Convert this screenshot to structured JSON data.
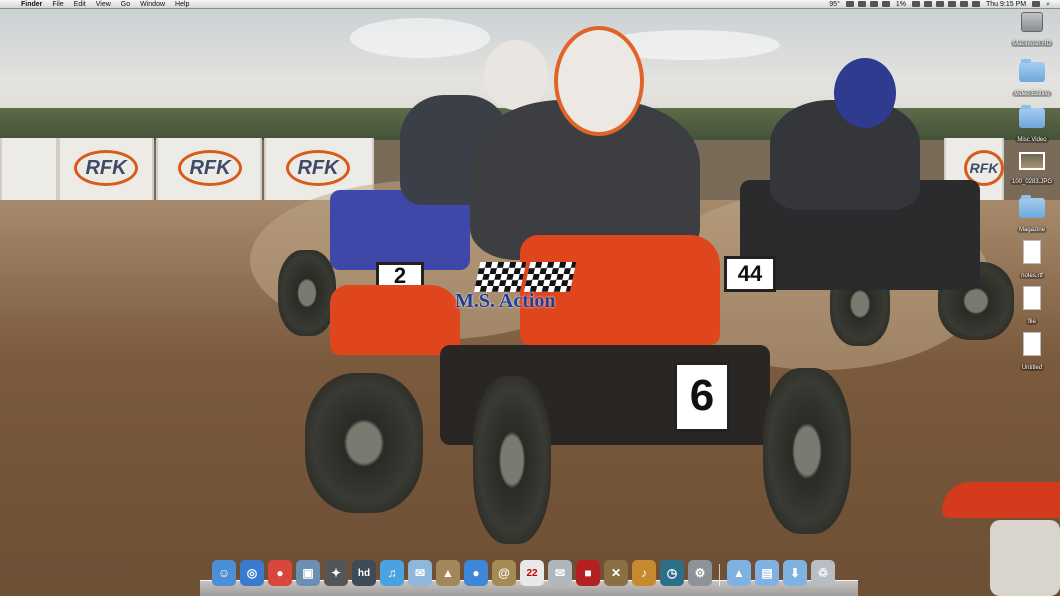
{
  "menubar": {
    "apple": "",
    "app_name": "Finder",
    "items": [
      "File",
      "Edit",
      "View",
      "Go",
      "Window",
      "Help"
    ],
    "status": {
      "temperature": "95°",
      "battery": "1%",
      "clock": "Thu 9:15 PM"
    }
  },
  "desktop": {
    "items": [
      {
        "label": "Macintosh HD",
        "icon": "hard-drive-icon"
      },
      {
        "label": "Video Editing",
        "icon": "folder-icon"
      },
      {
        "label": "Misc Video",
        "icon": "folder-icon"
      },
      {
        "label": "100_0283.JPG",
        "icon": "photo-icon"
      },
      {
        "label": "Magazine",
        "icon": "folder-icon"
      },
      {
        "label": "notes.rtf",
        "icon": "document-icon"
      },
      {
        "label": "file",
        "icon": "document-icon"
      },
      {
        "label": "Untitled",
        "icon": "rtf-document-icon"
      }
    ]
  },
  "wallpaper": {
    "banner_text": "RFK",
    "watermark": "M.S. Action",
    "plate_front": "6",
    "plate_right": "44",
    "plate_left": "2"
  },
  "dock": {
    "apps": [
      {
        "name": "finder-icon",
        "color": "#4b8fd6",
        "glyph": "☺"
      },
      {
        "name": "safari-icon",
        "color": "#3a7bd0",
        "glyph": "◎"
      },
      {
        "name": "chrome-icon",
        "color": "#d9463b",
        "glyph": "●"
      },
      {
        "name": "preview-icon",
        "color": "#6b8fb3",
        "glyph": "▣"
      },
      {
        "name": "imovie-icon",
        "color": "#555555",
        "glyph": "✦"
      },
      {
        "name": "hd-app-icon",
        "color": "#3f4a57",
        "glyph": "hd"
      },
      {
        "name": "itunes-icon",
        "color": "#4aa3e0",
        "glyph": "♫"
      },
      {
        "name": "mail-icon",
        "color": "#8fb7dc",
        "glyph": "✉"
      },
      {
        "name": "iphoto-icon",
        "color": "#a3875c",
        "glyph": "▲"
      },
      {
        "name": "facetime-icon",
        "color": "#3e86d8",
        "glyph": "●"
      },
      {
        "name": "address-book-icon",
        "color": "#a58a55",
        "glyph": "@"
      },
      {
        "name": "ical-icon",
        "color": "#e8e8e8",
        "glyph": "22"
      },
      {
        "name": "photo-booth-icon",
        "color": "#b0b6bd",
        "glyph": "✉"
      },
      {
        "name": "photobooth-red-icon",
        "color": "#b52020",
        "glyph": "■"
      },
      {
        "name": "toolbox-icon",
        "color": "#8b6f44",
        "glyph": "✕"
      },
      {
        "name": "garageband-icon",
        "color": "#c58a2e",
        "glyph": "♪"
      },
      {
        "name": "time-machine-icon",
        "color": "#2d6f86",
        "glyph": "◷"
      },
      {
        "name": "system-preferences-icon",
        "color": "#8e9399",
        "glyph": "⚙"
      }
    ],
    "stacks": [
      {
        "name": "applications-folder-icon",
        "color": "#7fb1e3",
        "glyph": "▲"
      },
      {
        "name": "documents-folder-icon",
        "color": "#7fb1e3",
        "glyph": "▤"
      },
      {
        "name": "downloads-folder-icon",
        "color": "#7fb1e3",
        "glyph": "⬇"
      },
      {
        "name": "trash-icon",
        "color": "#b9bec4",
        "glyph": "♲"
      }
    ]
  }
}
